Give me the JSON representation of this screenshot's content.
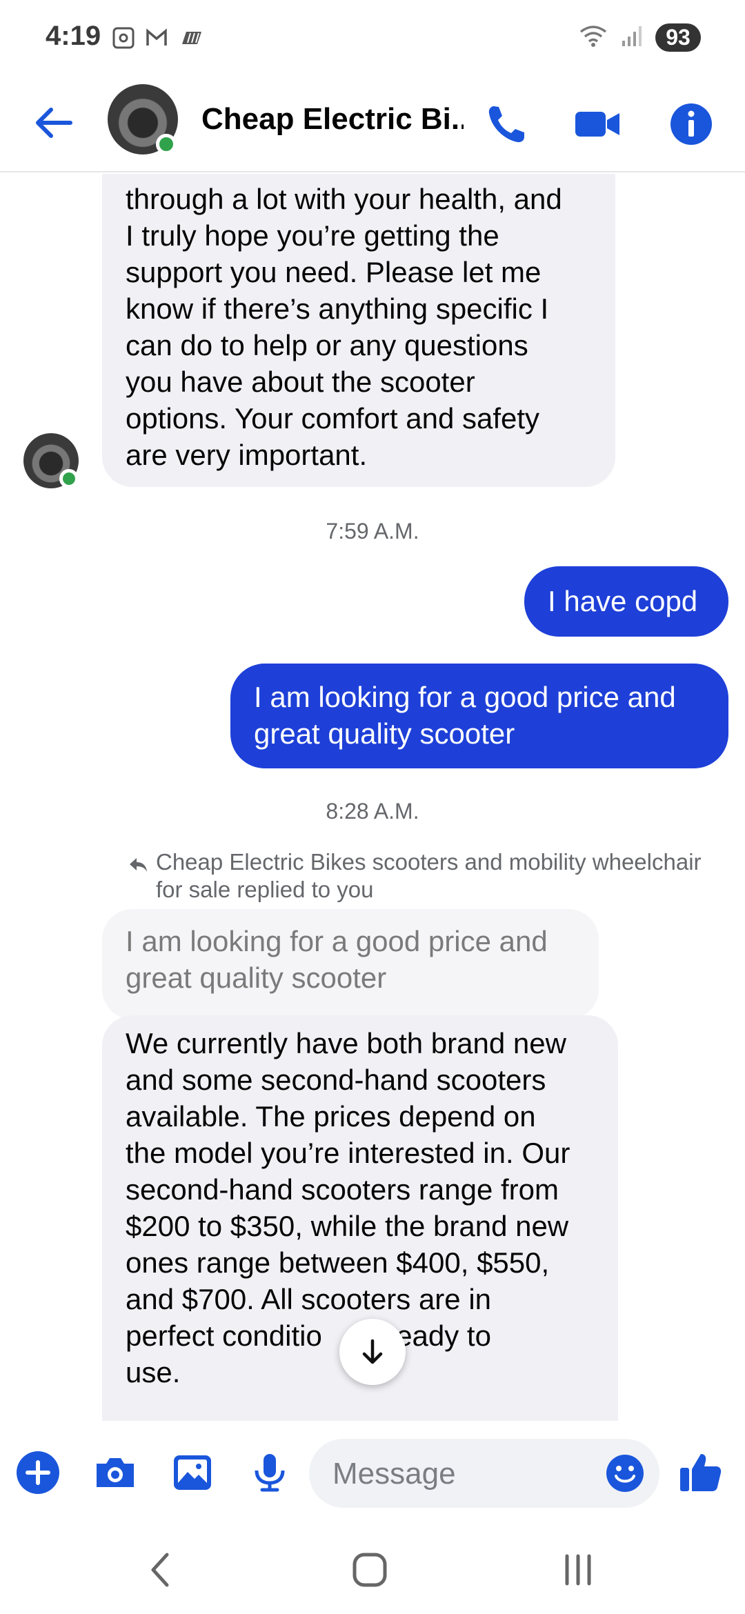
{
  "status_bar": {
    "time": "4:19",
    "battery": "93"
  },
  "header": {
    "contact_name": "Cheap Electric Bi..."
  },
  "messages": {
    "incoming_1": [
      "through a lot with your health, and",
      "I truly hope you’re getting the",
      "support you need. Please let me",
      "know if there’s anything specific I",
      "can do to help or any questions",
      "you have about the scooter",
      "options. Your comfort and safety",
      "are very important."
    ],
    "time_1": "7:59 A.M.",
    "outgoing_1": "I have copd",
    "outgoing_2": [
      "I am looking for a good price and",
      "great quality  scooter"
    ],
    "time_2": "8:28 A.M.",
    "reply_note": "Cheap Electric Bikes scooters and mobility wheelchair for sale replied to you",
    "quoted": [
      "I am looking for a good price and",
      "great quality  scooter"
    ],
    "incoming_2": [
      "We currently have both brand new",
      "and some second-hand scooters",
      "available. The prices depend on",
      "the model you’re interested in. Our",
      "second-hand scooters range from",
      "$200 to $350, while the brand new",
      "ones range between $400, $550,",
      "and $700. All scooters are in",
      "perfect conditio     d ready to",
      "use."
    ]
  },
  "composer": {
    "placeholder": "Message"
  },
  "colors": {
    "accent": "#1e40d8",
    "icon_blue": "#1a56db",
    "incoming_bg": "#f0f0f5",
    "online": "#31a24c"
  },
  "icons": [
    "back-arrow-icon",
    "phone-icon",
    "video-icon",
    "info-icon",
    "plus-icon",
    "camera-icon",
    "image-icon",
    "mic-icon",
    "emoji-icon",
    "thumbs-up-icon",
    "chevron-back-icon",
    "home-icon",
    "recents-icon"
  ]
}
